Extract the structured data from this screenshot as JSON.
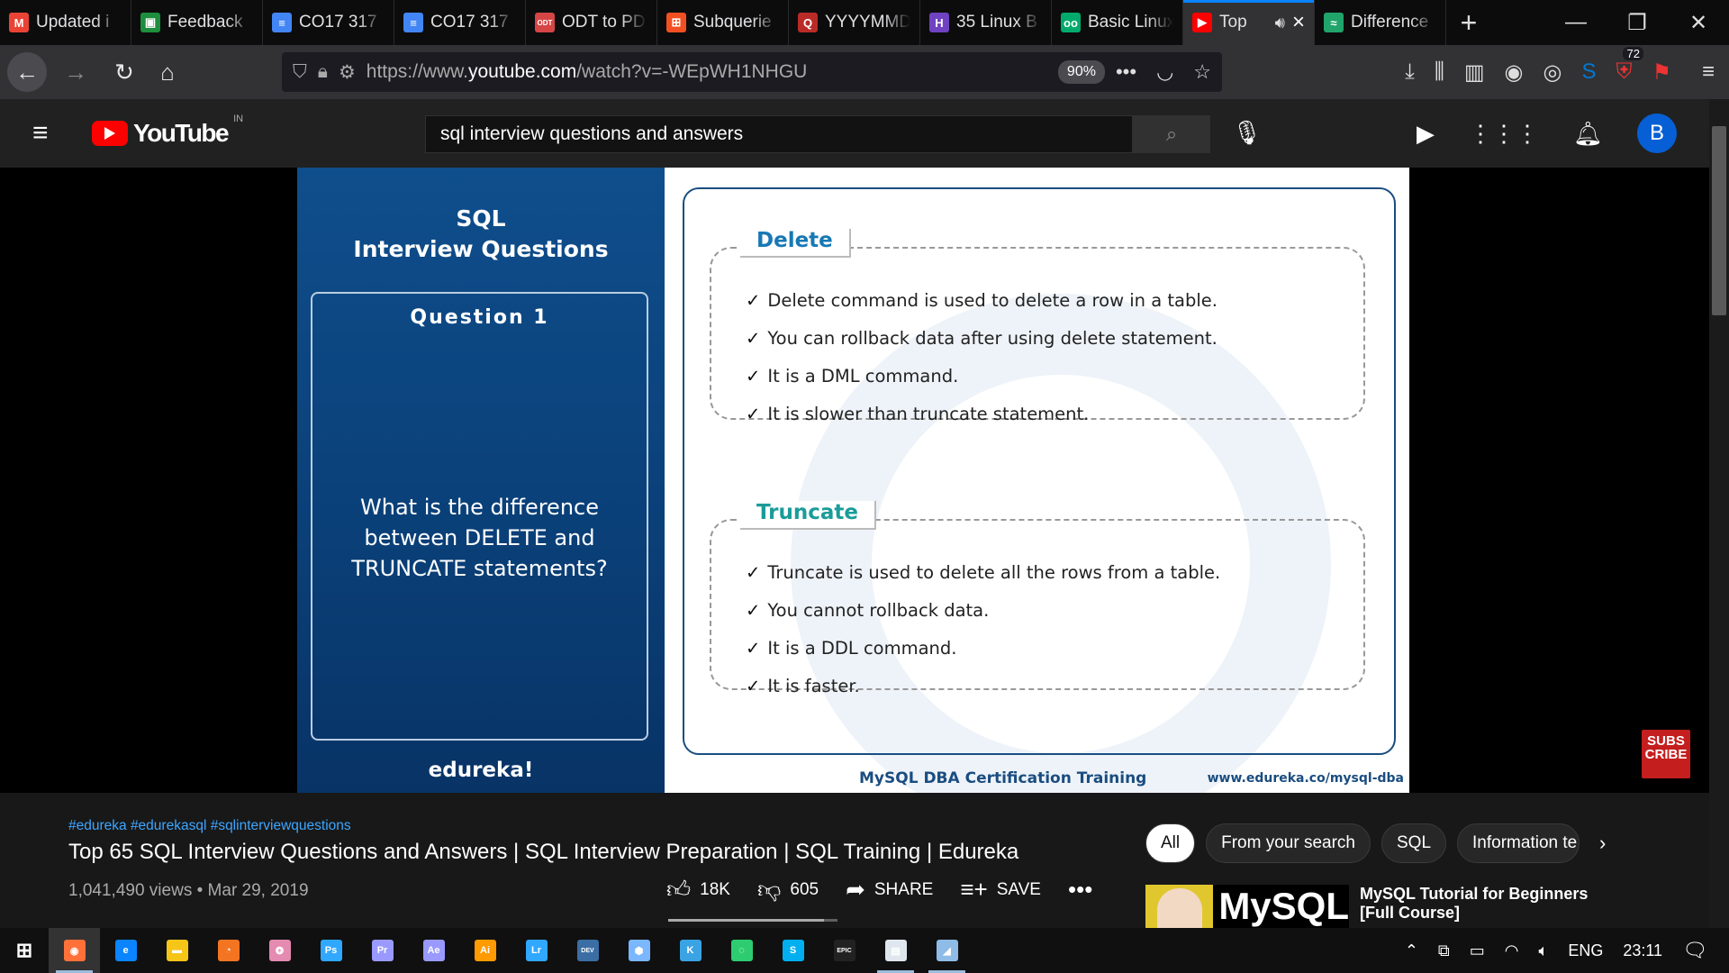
{
  "browser": {
    "tabs": [
      {
        "label": "Updated i",
        "icon": "gmail-icon",
        "color": "#ea4335",
        "glyph": "M"
      },
      {
        "label": "Feedback",
        "icon": "classroom-icon",
        "color": "#1e8e3e",
        "glyph": "▣"
      },
      {
        "label": "CO17 317",
        "icon": "docs-icon",
        "color": "#4285f4",
        "glyph": "≡"
      },
      {
        "label": "CO17 317",
        "icon": "docs-icon",
        "color": "#4285f4",
        "glyph": "≡"
      },
      {
        "label": "ODT to PD",
        "icon": "odt-icon",
        "color": "#d64545",
        "glyph": "ODT"
      },
      {
        "label": "Subquerie",
        "icon": "microsoft-icon",
        "color": "#f25022",
        "glyph": "⊞"
      },
      {
        "label": "YYYYMMD",
        "icon": "quora-icon",
        "color": "#b92b27",
        "glyph": "Q"
      },
      {
        "label": "35 Linux B",
        "icon": "hackernoon-icon",
        "color": "#6f42c1",
        "glyph": "H"
      },
      {
        "label": "Basic Linux",
        "icon": "tripadvisor-icon",
        "color": "#00aa6c",
        "glyph": "oo"
      },
      {
        "label": "Top",
        "icon": "youtube-icon",
        "color": "#ff0000",
        "glyph": "▶",
        "active": true
      },
      {
        "label": "Difference",
        "icon": "diff-icon",
        "color": "#20a46b",
        "glyph": "≈"
      }
    ],
    "new_tab": "+",
    "url_prefix": "https://www.",
    "url_host": "youtube.com",
    "url_path": "/watch?v=-WEpWH1NHGU",
    "zoom": "90%",
    "badge_count": "72"
  },
  "youtube": {
    "country": "IN",
    "logo_text": "YouTube",
    "search_query": "sql interview questions and answers",
    "avatar_letter": "B"
  },
  "slide": {
    "title_line1": "SQL",
    "title_line2": "Interview Questions",
    "question_number": "Question 1",
    "question_text": "What is the difference between DELETE and TRUNCATE statements?",
    "brand": "edureka!",
    "delete_head": "Delete",
    "delete_points": [
      "Delete command is used to delete a row in a table.",
      "You can rollback data after using delete statement.",
      "It is a DML command.",
      "It is slower than truncate statement."
    ],
    "truncate_head": "Truncate",
    "truncate_points": [
      "Truncate is used to delete all the rows from a table.",
      "You cannot rollback data.",
      "It is a DDL command.",
      "It is faster."
    ],
    "footer_left": "MySQL DBA Certification Training",
    "footer_right": "www.edureka.co/mysql-dba",
    "subscribe": "SUBS CRIBE"
  },
  "video": {
    "hashtags": "#edureka #edurekasql #sqlinterviewquestions",
    "title": "Top 65 SQL Interview Questions and Answers | SQL Interview Preparation | SQL Training | Edureka",
    "views": "1,041,490 views",
    "date": "Mar 29, 2019",
    "likes": "18K",
    "dislikes": "605",
    "share": "SHARE",
    "save": "SAVE",
    "like_ratio": 0.92
  },
  "chips": [
    "All",
    "From your search",
    "SQL",
    "Information te"
  ],
  "recommendation": {
    "thumb_text": "MySQL",
    "title": "MySQL Tutorial for Beginners [Full Course]"
  },
  "taskbar": {
    "apps": [
      {
        "name": "firefox-icon",
        "glyph": "◉",
        "color": "#ff7139",
        "run": true,
        "act": true
      },
      {
        "name": "edge-icon",
        "glyph": "e",
        "color": "#0a84ff"
      },
      {
        "name": "file-explorer-icon",
        "glyph": "▬",
        "color": "#f5c518"
      },
      {
        "name": "crunchyroll-icon",
        "glyph": "◔",
        "color": "#f47521"
      },
      {
        "name": "brain-icon",
        "glyph": "❂",
        "color": "#e58ab0"
      },
      {
        "name": "photoshop-icon",
        "glyph": "Ps",
        "color": "#31a8ff"
      },
      {
        "name": "premiere-icon",
        "glyph": "Pr",
        "color": "#9999ff"
      },
      {
        "name": "after-effects-icon",
        "glyph": "Ae",
        "color": "#9999ff"
      },
      {
        "name": "illustrator-icon",
        "glyph": "Ai",
        "color": "#ff9a00"
      },
      {
        "name": "lightroom-icon",
        "glyph": "Lr",
        "color": "#31a8ff"
      },
      {
        "name": "devcpp-icon",
        "glyph": "DEV",
        "color": "#3a6ea5"
      },
      {
        "name": "hexagon-app-icon",
        "glyph": "⬢",
        "color": "#7ab7ff"
      },
      {
        "name": "krita-icon",
        "glyph": "K",
        "color": "#3aa3e3"
      },
      {
        "name": "spinner-app-icon",
        "glyph": "◌",
        "color": "#2ecc71"
      },
      {
        "name": "skype-icon",
        "glyph": "S",
        "color": "#00aff0"
      },
      {
        "name": "epic-games-icon",
        "glyph": "EPIC",
        "color": "#222"
      },
      {
        "name": "notepad-icon",
        "glyph": "▤",
        "color": "#dfe6ee",
        "run": true
      },
      {
        "name": "paint-icon",
        "glyph": "◢",
        "color": "#8fbce6",
        "run": true
      }
    ],
    "language": "ENG",
    "time": "23:11"
  }
}
